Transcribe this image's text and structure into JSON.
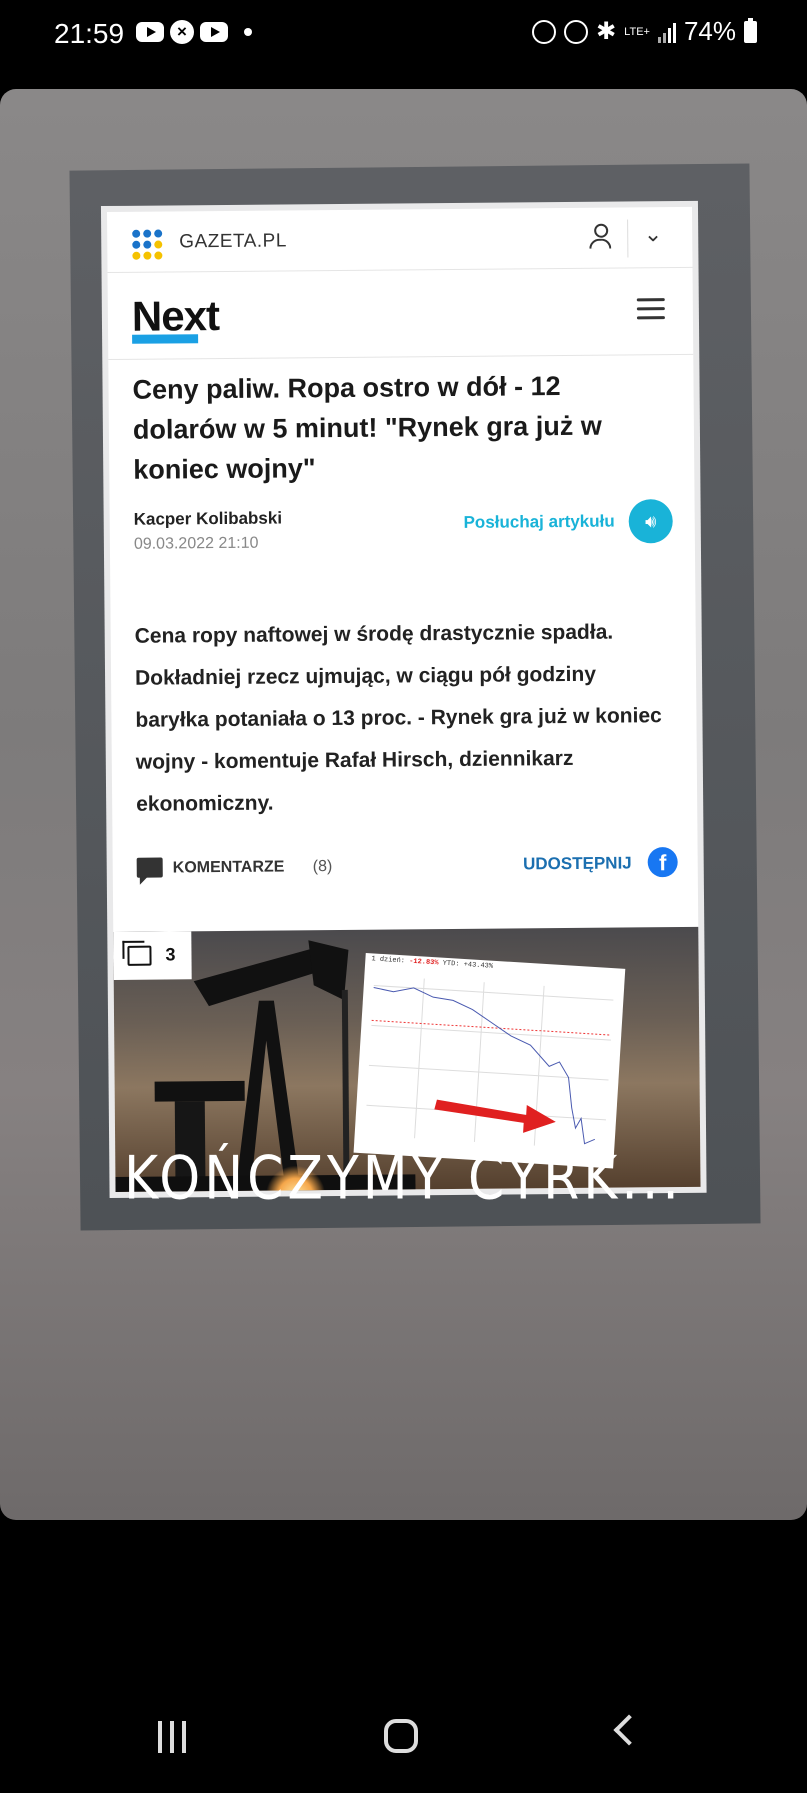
{
  "status_bar": {
    "time": "21:59",
    "battery_text": "74%",
    "network_label": "LTE+",
    "left_icons": [
      "youtube-icon",
      "xbox-icon",
      "youtube-icon",
      "dot-icon"
    ],
    "right_icons": [
      "recycle-icon",
      "alarm-icon",
      "bluetooth-icon",
      "signal-icon",
      "battery-icon"
    ]
  },
  "article": {
    "site_name": "GAZETA.PL",
    "section_logo": "Next",
    "headline": "Ceny paliw. Ropa ostro w dół - 12 dolarów w 5 minut! \"Rynek gra już w koniec wojny\"",
    "author": "Kacper Kolibabski",
    "date": "09.03.2022 21:10",
    "listen_label": "Posłuchaj artykułu",
    "lead": "Cena ropy naftowej w środę drastycznie spadła. Dokładniej rzecz ujmując, w ciągu pół godziny baryłka potaniała o 13 proc. - Rynek gra już w koniec wojny - komentuje Rafał Hirsch, dziennikarz ekonomiczny.",
    "comments_label": "KOMENTARZE",
    "comments_count": "(8)",
    "share_label": "UDOSTĘPNIJ",
    "gallery_count": "3",
    "chart_header_prefix": "1 dzień: ",
    "chart_header_change": "-12.83%",
    "chart_header_suffix": " YTD: +43.43%"
  },
  "story": {
    "caption": "KOŃCZYMY CYRK..."
  },
  "colors": {
    "accent_blue": "#19b3d8",
    "share_blue": "#1b6fb0",
    "facebook": "#1877f2",
    "next_underline": "#1aa0e4"
  }
}
